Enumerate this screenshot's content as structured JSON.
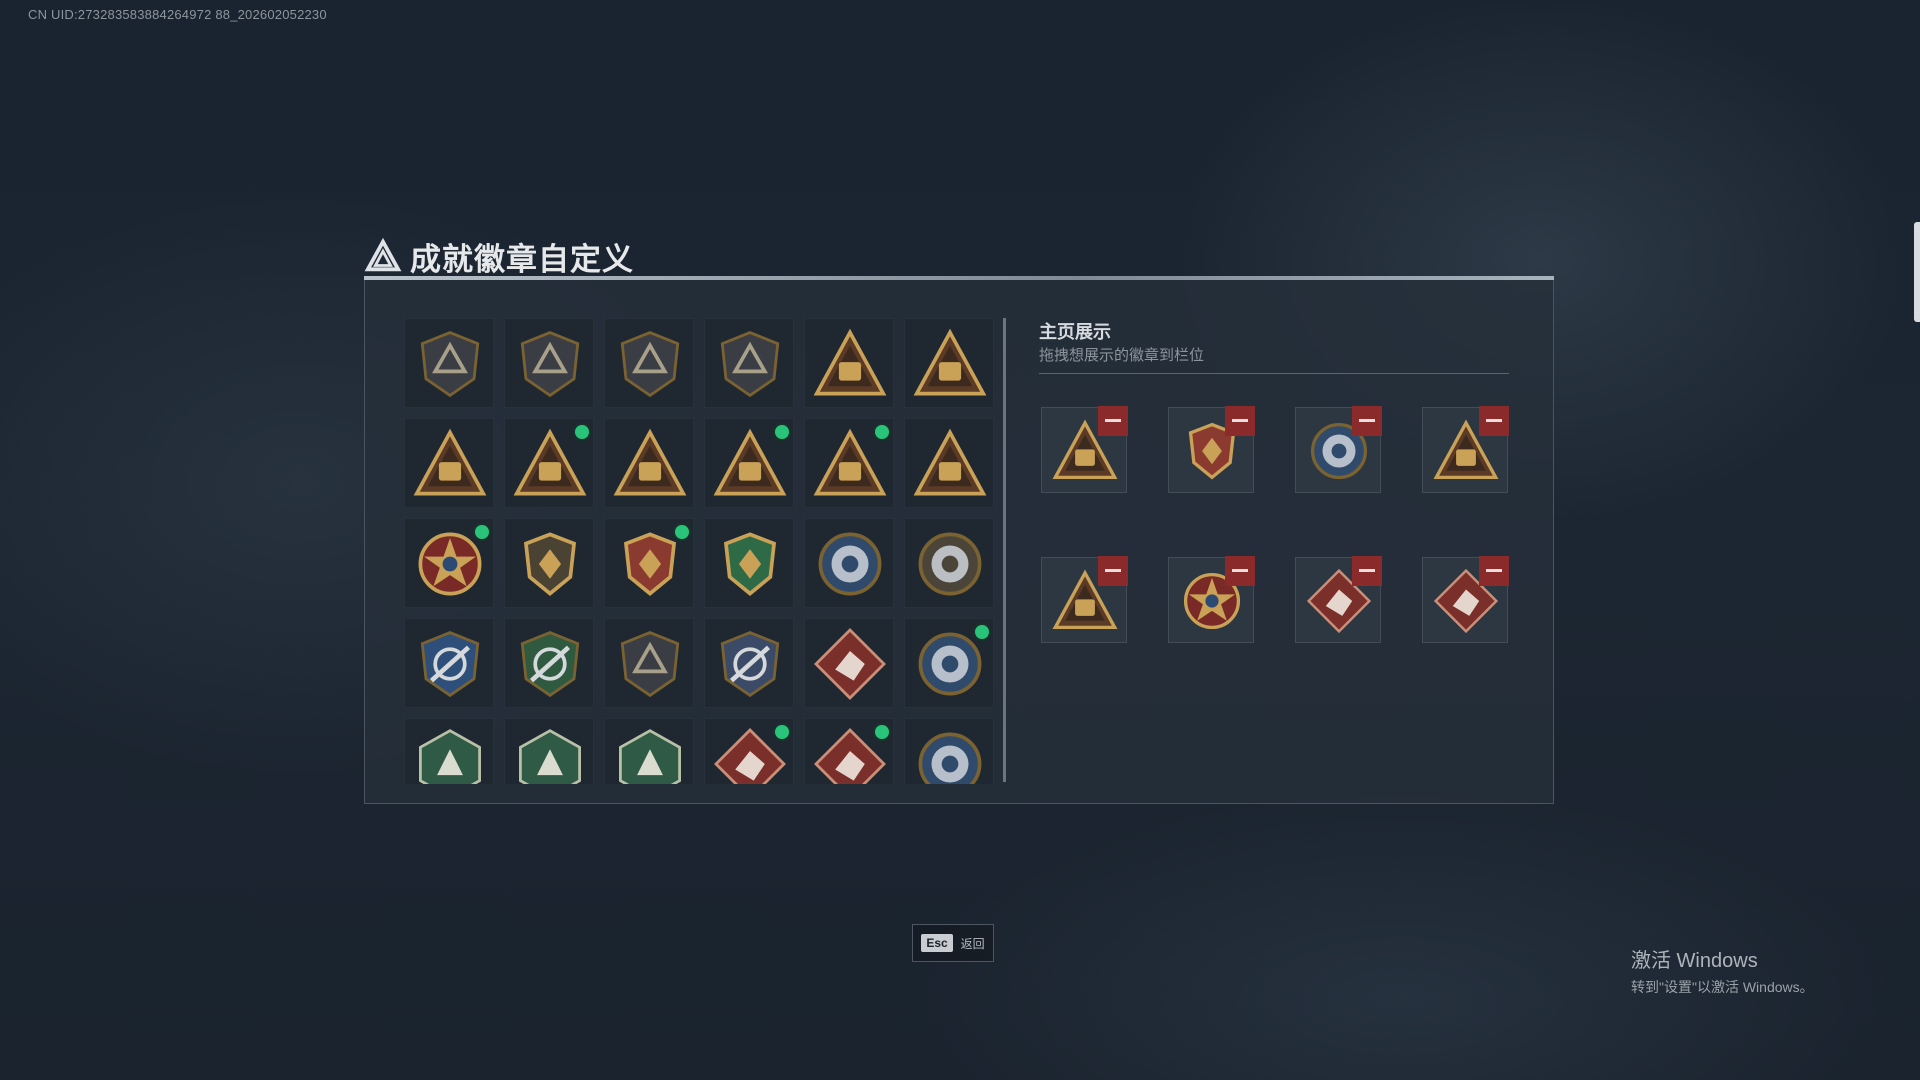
{
  "uid_text": "CN UID:273283583884264972 88_202602052230",
  "title": "成就徽章自定义",
  "right_panel": {
    "title": "主页展示",
    "subtitle": "拖拽想展示的徽章到栏位"
  },
  "footer": {
    "esc_key": "Esc",
    "esc_label": "返回"
  },
  "windows_watermark": {
    "title": "激活 Windows",
    "subtitle": "转到\"设置\"以激活 Windows。"
  },
  "badge_grid": [
    [
      {
        "icon": "pyramid-shield-badge",
        "new": false
      },
      {
        "icon": "helicopter-shield-badge",
        "new": false
      },
      {
        "icon": "diamond-shield-badge",
        "new": false
      },
      {
        "icon": "sword-shield-badge",
        "new": false
      },
      {
        "icon": "bag-55-triangle-badge",
        "new": false
      },
      {
        "icon": "crown-56-triangle-badge",
        "new": false
      }
    ],
    [
      {
        "icon": "box-triangle-badge",
        "new": false
      },
      {
        "icon": "hat-triangle-badge",
        "new": true
      },
      {
        "icon": "number-1-triangle-badge",
        "new": false
      },
      {
        "icon": "crate-triangle-badge",
        "new": true
      },
      {
        "icon": "heart-triangle-badge",
        "new": true
      },
      {
        "icon": "soldiers-triangle-badge",
        "new": false
      }
    ],
    [
      {
        "icon": "star-emblem-badge",
        "new": true
      },
      {
        "icon": "gold-shield-badge",
        "new": false
      },
      {
        "icon": "winged-shield-badge",
        "new": true
      },
      {
        "icon": "green-shield-badge",
        "new": false
      },
      {
        "icon": "blue-skull-medal-badge",
        "new": false
      },
      {
        "icon": "round-crest-badge",
        "new": false
      }
    ],
    [
      {
        "icon": "blue-rifle-shield-badge",
        "new": false
      },
      {
        "icon": "green-rifle-shield-badge",
        "new": false
      },
      {
        "icon": "target-shield-badge",
        "new": false
      },
      {
        "icon": "crossed-rifles-badge",
        "new": false
      },
      {
        "icon": "red-wolf-diamond-badge",
        "new": false
      },
      {
        "icon": "eagle-round-badge",
        "new": true
      }
    ],
    [
      {
        "icon": "green-beast-badge",
        "new": false
      },
      {
        "icon": "green-runner-badge",
        "new": false
      },
      {
        "icon": "green-soldier-badge",
        "new": false
      },
      {
        "icon": "red-dragon-diamond-badge",
        "new": true
      },
      {
        "icon": "red-runner-diamond-badge",
        "new": true
      },
      {
        "icon": "blue-wolf-round-badge",
        "new": false
      }
    ]
  ],
  "showcase_slots": [
    {
      "icon": "heart-triangle-badge"
    },
    {
      "icon": "winged-shield-badge"
    },
    {
      "icon": "eagle-round-badge"
    },
    {
      "icon": "crate-triangle-badge"
    },
    {
      "icon": "hat-triangle-badge"
    },
    {
      "icon": "star-emblem-badge"
    },
    {
      "icon": "red-dragon-diamond-badge"
    },
    {
      "icon": "red-runner-diamond-badge"
    }
  ],
  "colors": {
    "new_dot": "#29c47a",
    "remove_button": "#8a2a2a",
    "gold": "#c9a257",
    "panel_bg": "#262f3a"
  }
}
